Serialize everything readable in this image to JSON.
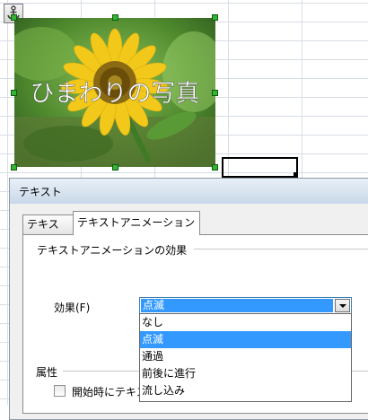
{
  "photo": {
    "caption": "ひまわりの写真"
  },
  "dialog": {
    "title": "テキスト",
    "tabs": [
      {
        "label": "テキスト"
      },
      {
        "label": "テキストアニメーション"
      }
    ],
    "section_effects": "テキストアニメーションの効果",
    "effect_label": "効果(F)",
    "effect_selected": "点滅",
    "effect_options": [
      "なし",
      "点滅",
      "通過",
      "前後に進行",
      "流し込み"
    ],
    "section_properties": "属性",
    "start_checkbox_label": "開始時にテキス"
  },
  "colors": {
    "selection": "#3399ff",
    "handle": "#34b334"
  },
  "icons": {
    "anchor": "anchor-icon",
    "dropdown": "chevron-down-icon"
  }
}
